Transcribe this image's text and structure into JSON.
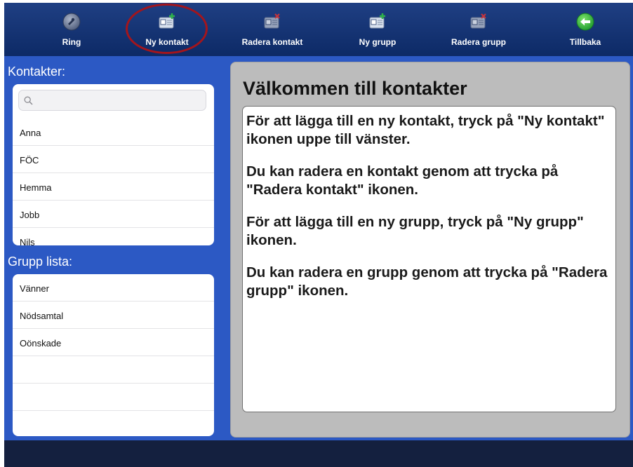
{
  "toolbar": {
    "items": [
      {
        "label": "Ring",
        "icon": "phone-icon"
      },
      {
        "label": "Ny kontakt",
        "icon": "add-contact-icon"
      },
      {
        "label": "Radera kontakt",
        "icon": "delete-contact-icon"
      },
      {
        "label": "Ny grupp",
        "icon": "add-group-icon"
      },
      {
        "label": "Radera grupp",
        "icon": "delete-group-icon"
      },
      {
        "label": "Tillbaka",
        "icon": "back-arrow-icon"
      }
    ],
    "highlighted": "Ny kontakt"
  },
  "contacts": {
    "header": "Kontakter:",
    "search_placeholder": "",
    "items": [
      "Anna",
      "FÖC",
      "Hemma",
      "Jobb",
      "Nils"
    ]
  },
  "groups": {
    "header": "Grupp lista:",
    "items": [
      "Vänner",
      "Nödsamtal",
      "Oönskade"
    ]
  },
  "welcome": {
    "title": "Välkommen till kontakter",
    "paragraphs": [
      "För att lägga till en ny kontakt, tryck på \"Ny kontakt\" ikonen uppe till vänster.",
      "Du kan radera en kontakt genom att trycka på \"Radera kontakt\" ikonen.",
      "För att lägga till en ny grupp, tryck på \"Ny grupp\" ikonen.",
      "Du kan radera en grupp genom att trycka på \"Radera grupp\" ikonen."
    ]
  },
  "colors": {
    "app_background": "#2c59c4",
    "toolbar": "#10306f",
    "highlight_ring": "#a4151c",
    "bottom_bar": "#14203f",
    "content_panel": "#bcbcbc"
  }
}
